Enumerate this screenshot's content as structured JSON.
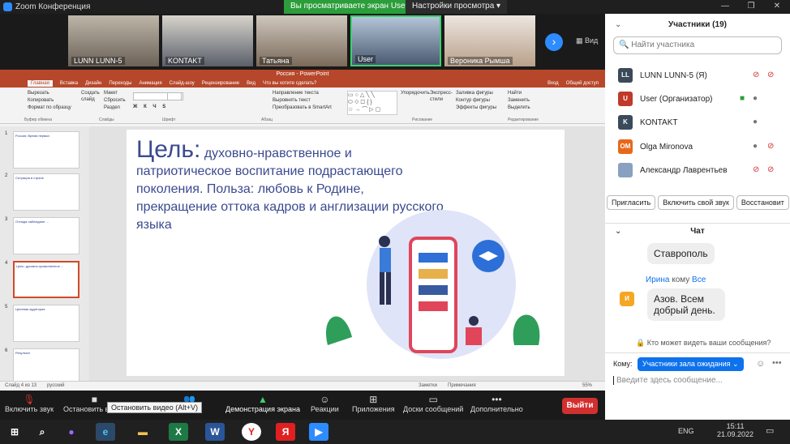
{
  "window": {
    "title": "Zoom Конференция",
    "share_banner": "Вы просматриваете экран User",
    "view_options": "Настройки просмотра"
  },
  "strip": {
    "tiles": [
      {
        "name": "LUNN LUNN-5"
      },
      {
        "name": "KONTAKT"
      },
      {
        "name": "Татьяна"
      },
      {
        "name": "User"
      },
      {
        "name": "Вероника Рымша"
      }
    ],
    "view_label": "Вид"
  },
  "ppt": {
    "title": "Россия - PowerPoint",
    "tabs": [
      "Главная",
      "Вставка",
      "Дизайн",
      "Переходы",
      "Анимация",
      "Слайд-шоу",
      "Рецензирование",
      "Вид",
      "Что вы хотите сделать?",
      "Вход",
      "Общий доступ"
    ],
    "ribbon": {
      "cut": "Вырезать",
      "copy": "Копировать",
      "format": "Формат по образцу",
      "clipboard": "Буфер обмена",
      "new_slide": "Создать слайд",
      "layout": "Макет",
      "reset": "Сбросить",
      "section": "Раздел",
      "slides": "Слайды",
      "font": "Шрифт",
      "paragraph": "Абзац",
      "text_dir": "Направление текста",
      "align_text": "Выровнять текст",
      "smartart": "Преобразовать в SmartArt",
      "arrange": "Упорядочить",
      "quick_styles": "Экспресс-стили",
      "fill": "Заливка фигуры",
      "outline": "Контур фигуры",
      "effects": "Эффекты фигуры",
      "drawing": "Рисование",
      "find": "Найти",
      "replace": "Заменить",
      "select": "Выделить",
      "editing": "Редактирование"
    },
    "thumbs": [
      "Россия: Время первых",
      "Ситуация в стране",
      "Отсюда наблюдают ...",
      "Цель: духовно-нравственное ...",
      "Целевая аудитория",
      "Результат"
    ],
    "slide": {
      "heading_big": "Цель:",
      "heading_rest": "духовно-нравственное и патриотическое воспитание подрастающего поколения. Польза: любовь к Родине, прекращение оттока кадров и англизации русского языка"
    },
    "status": {
      "slide": "Слайд 4 из 13",
      "lang": "русский",
      "notes": "Заметки",
      "comments": "Примечания",
      "zoom": "55%"
    }
  },
  "toolbar": {
    "mute": "Включить звук",
    "video": "Остановить видео",
    "participants_count": "19",
    "share": "Демонстрация экрана",
    "reactions": "Реакции",
    "apps": "Приложения",
    "whiteboards": "Доски сообщений",
    "more": "Дополнительно",
    "leave": "Выйти",
    "tooltip": "Остановить видео (Alt+V)"
  },
  "taskbar": {
    "lang": "ENG",
    "time": "15:11",
    "date": "21.09.2022"
  },
  "participants": {
    "header": "Участники (19)",
    "search_placeholder": "Найти участника",
    "list": [
      {
        "initials": "LL",
        "name": "LUNN LUNN-5 (Я)",
        "color": "#3a4a5a"
      },
      {
        "initials": "U",
        "name": "User (Организатор)",
        "color": "#c0392b"
      },
      {
        "initials": "K",
        "name": "KONTAKT",
        "color": "#3a4a5a"
      },
      {
        "initials": "OM",
        "name": "Olga Mironova",
        "color": "#e8681a"
      },
      {
        "initials": "",
        "name": "Александр Лаврентьев",
        "color": "#8aa0c0"
      }
    ],
    "invite": "Пригласить",
    "unmute_me": "Включить свой звук",
    "reclaim": "Восстановит"
  },
  "chat": {
    "header": "Чат",
    "msg1": "Ставрополь",
    "sender": "Ирина",
    "to": "кому",
    "recipient": "Все",
    "avatar": "И",
    "msg2": "Азов. Всем добрый день.",
    "who_sees": "Кто может видеть ваши сообщения?",
    "to_label": "Кому:",
    "recipient_select": "Участники зала ожидания",
    "input_placeholder": "Введите здесь сообщение..."
  }
}
